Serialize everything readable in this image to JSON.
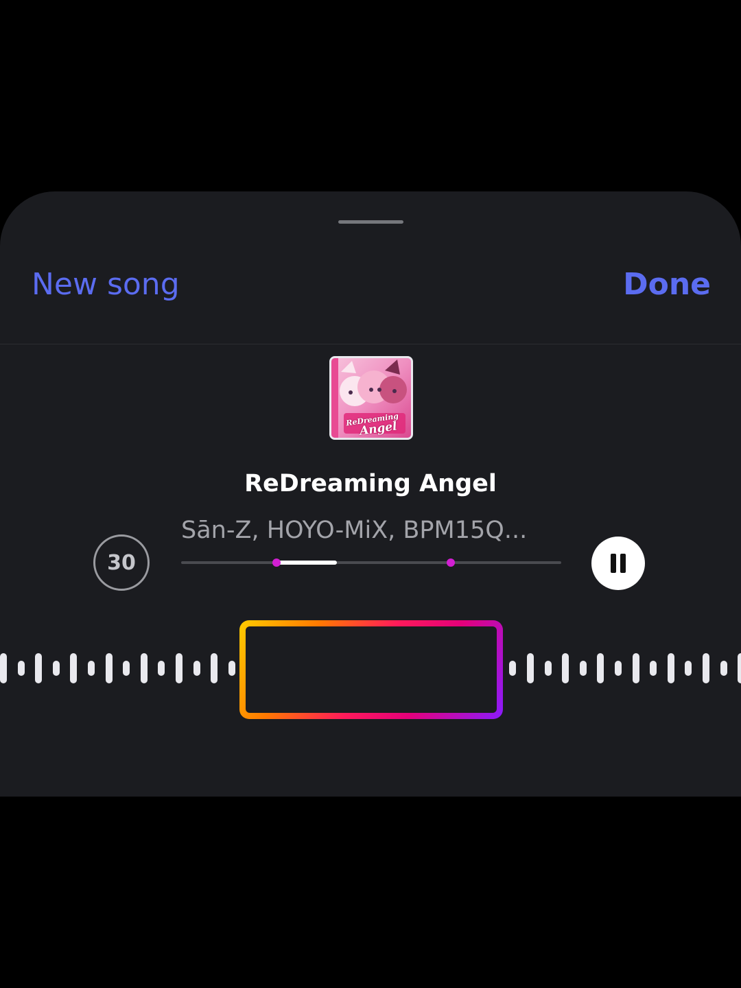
{
  "header": {
    "new_song_label": "New song",
    "done_label": "Done",
    "accent_color": "#5b6cf0"
  },
  "track": {
    "title": "ReDreaming Angel",
    "artists": "Sān-Z, HOYO-MiX, BPM15Q...",
    "cover_text_line1": "ReDreaming",
    "cover_text_line2": "Angel"
  },
  "controls": {
    "skip_label": "30",
    "skip_icon": "skip-30-icon",
    "play_state_icon": "pause-icon",
    "marker_color": "#d21fd2"
  },
  "progress": {
    "selection_start_fraction": 0.25,
    "selection_end_fraction": 0.41,
    "second_marker_fraction": 0.71
  }
}
